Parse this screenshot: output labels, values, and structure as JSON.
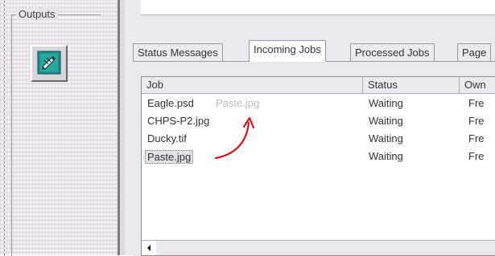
{
  "left_panel": {
    "group_label": "Outputs",
    "button_icon": "printer-pen-icon"
  },
  "tabs": [
    {
      "label": "Status Messages",
      "active": false
    },
    {
      "label": "Incoming Jobs",
      "active": true
    },
    {
      "label": "Processed Jobs",
      "active": false
    },
    {
      "label": "Page",
      "active": false
    }
  ],
  "table": {
    "columns": [
      "Job",
      "Status",
      "Own"
    ],
    "rows": [
      {
        "job": "Eagle.psd",
        "status": "Waiting",
        "owner": "Fre"
      },
      {
        "job": "CHPS-P2.jpg",
        "status": "Waiting",
        "owner": "Fre"
      },
      {
        "job": "Ducky.tif",
        "status": "Waiting",
        "owner": "Fre"
      },
      {
        "job": "Paste.jpg",
        "status": "Waiting",
        "owner": "Fre"
      }
    ],
    "drag_ghost_label": "Paste.jpg"
  },
  "colors": {
    "annotation_arrow": "#d4141c",
    "icon_background": "#1f8f8a"
  }
}
